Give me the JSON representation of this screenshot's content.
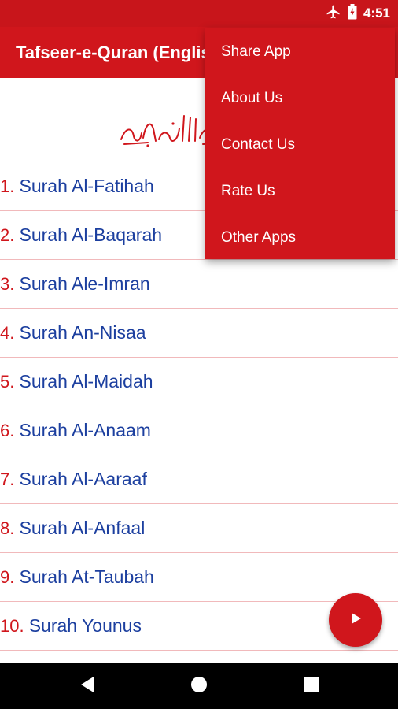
{
  "status_bar": {
    "time": "4:51",
    "icons": [
      "airplane-icon",
      "battery-icon"
    ]
  },
  "app_bar": {
    "title": "Tafseer-e-Quran (English)"
  },
  "header": {
    "image": "bismillah-calligraphy"
  },
  "surahs": [
    {
      "num": "1.",
      "name": "Surah Al-Fatihah"
    },
    {
      "num": "2.",
      "name": "Surah Al-Baqarah"
    },
    {
      "num": "3.",
      "name": "Surah Ale-Imran"
    },
    {
      "num": "4.",
      "name": "Surah An-Nisaa"
    },
    {
      "num": "5.",
      "name": "Surah Al-Maidah"
    },
    {
      "num": "6.",
      "name": "Surah Al-Anaam"
    },
    {
      "num": "7.",
      "name": "Surah Al-Aaraaf"
    },
    {
      "num": "8.",
      "name": "Surah Al-Anfaal"
    },
    {
      "num": "9.",
      "name": "Surah At-Taubah"
    },
    {
      "num": "10.",
      "name": "Surah Younus"
    }
  ],
  "overflow_menu": {
    "items": [
      "Share App",
      "About Us",
      "Contact Us",
      "Rate Us",
      "Other Apps"
    ]
  },
  "fab": {
    "icon": "play-icon"
  },
  "nav_bar": {
    "buttons": [
      "back-icon",
      "home-icon",
      "recents-icon"
    ]
  },
  "colors": {
    "primary": "#d0161c",
    "status_bar": "#c8151b",
    "surah_name": "#1c3f9f",
    "divider": "#f1b9bb"
  }
}
